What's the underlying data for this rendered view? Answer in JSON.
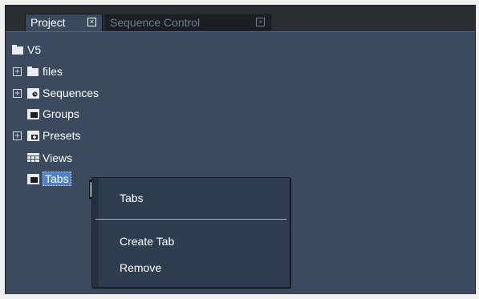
{
  "tabs": [
    {
      "label": "Project",
      "close_icon": "close-box-icon"
    },
    {
      "label": "Sequence Control",
      "close_icon": "close-box-icon"
    }
  ],
  "tree": {
    "root": {
      "label": "V5",
      "icon": "folder-icon"
    },
    "items": [
      {
        "label": "files",
        "icon": "folder-icon",
        "expandable": true
      },
      {
        "label": "Sequences",
        "icon": "sequences-folder-icon",
        "expandable": true
      },
      {
        "label": "Groups",
        "icon": "groups-folder-icon",
        "expandable": false
      },
      {
        "label": "Presets",
        "icon": "presets-folder-icon",
        "expandable": true
      },
      {
        "label": "Views",
        "icon": "views-grid-icon",
        "expandable": false
      },
      {
        "label": "Tabs",
        "icon": "tabs-folder-icon",
        "expandable": false,
        "selected": true
      }
    ]
  },
  "context_menu": {
    "header": "Tabs",
    "items": [
      "Create Tab",
      "Remove"
    ]
  },
  "expander_symbol": "+",
  "tab_close_symbol": "×",
  "colors": {
    "panel_bg": "#3b4a5e",
    "active_tab": "#3a4a5e",
    "selection": "#4f7fd0",
    "menu_bg": "#2f3d50"
  }
}
